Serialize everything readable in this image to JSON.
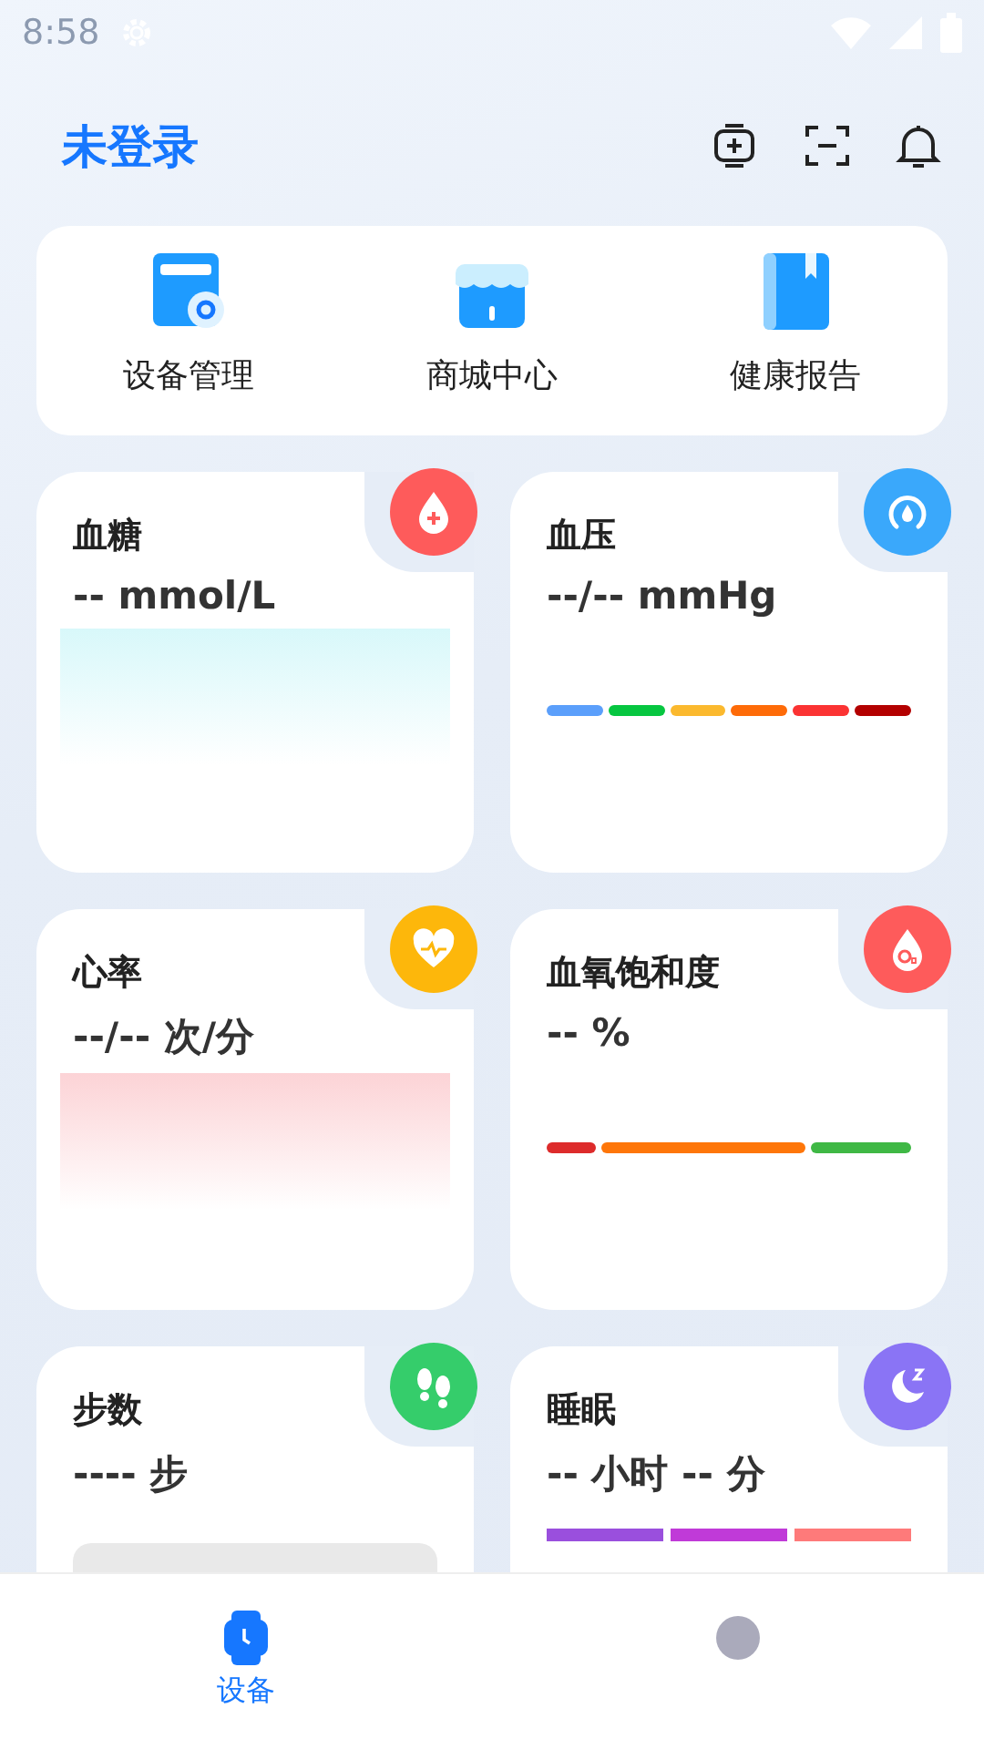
{
  "status_bar": {
    "time": "8:58"
  },
  "header": {
    "title": "未登录"
  },
  "shortcuts": [
    {
      "label": "设备管理",
      "kind": "device"
    },
    {
      "label": "商城中心",
      "kind": "store"
    },
    {
      "label": "健康报告",
      "kind": "report"
    }
  ],
  "cards": [
    {
      "title": "血糖",
      "reading": "-- mmol/L",
      "color": "#fe5b5b",
      "kind": "area"
    },
    {
      "title": "血压",
      "reading": "--/-- mmHg",
      "color": "#3aa8fb",
      "kind": "range",
      "segments": [
        {
          "color": "#5b9ffb"
        },
        {
          "color": "#06c640"
        },
        {
          "color": "#fbb92e"
        },
        {
          "color": "#fe6b08"
        },
        {
          "color": "#fb3333"
        },
        {
          "color": "#b30000"
        }
      ]
    },
    {
      "title": "心率",
      "reading": "--/-- 次/分",
      "color": "#fdb70b",
      "kind": "area"
    },
    {
      "title": "血氧饱和度",
      "reading": "-- %",
      "color": "#fe5b5b",
      "kind": "range",
      "segments": [
        {
          "color": "#dd2b2b"
        },
        {
          "color": "#fe7609"
        },
        {
          "color": "#3fb845"
        }
      ]
    },
    {
      "title": "步数",
      "reading": "---- 步",
      "color": "#35cd6b",
      "kind": "track"
    },
    {
      "title": "睡眠",
      "reading": "-- 小时 -- 分",
      "color": "#8a74f5",
      "kind": "stages",
      "segments": [
        {
          "color": "#9a4fdd"
        },
        {
          "color": "#c03ad8"
        },
        {
          "color": "#fe7a7a"
        }
      ]
    }
  ],
  "tabs": [
    {
      "label": "设备",
      "selected": true
    },
    {
      "selected": false
    }
  ]
}
